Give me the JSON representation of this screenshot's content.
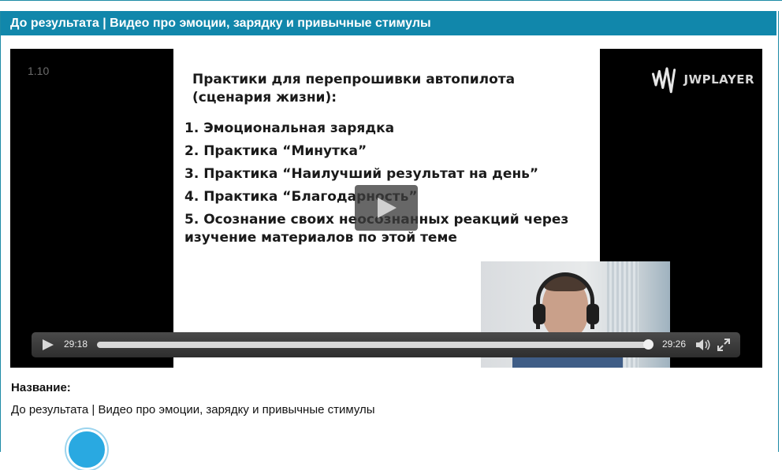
{
  "page": {
    "title": "До результата | Видео про эмоции, зарядку и привычные стимулы"
  },
  "player": {
    "overlay_time": "1.10",
    "logo_text": "JWPLAYER",
    "slide": {
      "heading": "Практики для перепрошивки автопилота (сценария жизни):",
      "items": [
        "1. Эмоциональная зарядка",
        "2. Практика “Минутка”",
        "3. Практика “Наилучший результат на день”",
        "4. Практика “Благодарность”",
        "5. Осознание своих неосознанных реакций через изучение материалов по этой теме"
      ]
    },
    "controls": {
      "elapsed": "29:18",
      "duration": "29:26",
      "progress": 0.995
    },
    "icons": {
      "play": "play-icon",
      "big_play": "big-play-icon",
      "volume": "volume-icon",
      "fullscreen": "fullscreen-icon",
      "logo": "jwplayer-logo-icon"
    }
  },
  "details": {
    "name_label": "Название:",
    "name_value": "До результата | Видео про эмоции, зарядку и привычные стимулы"
  },
  "colors": {
    "title_bar": "#1187ab",
    "player_bg": "#000000",
    "accent_icon": "#29a9e1"
  }
}
